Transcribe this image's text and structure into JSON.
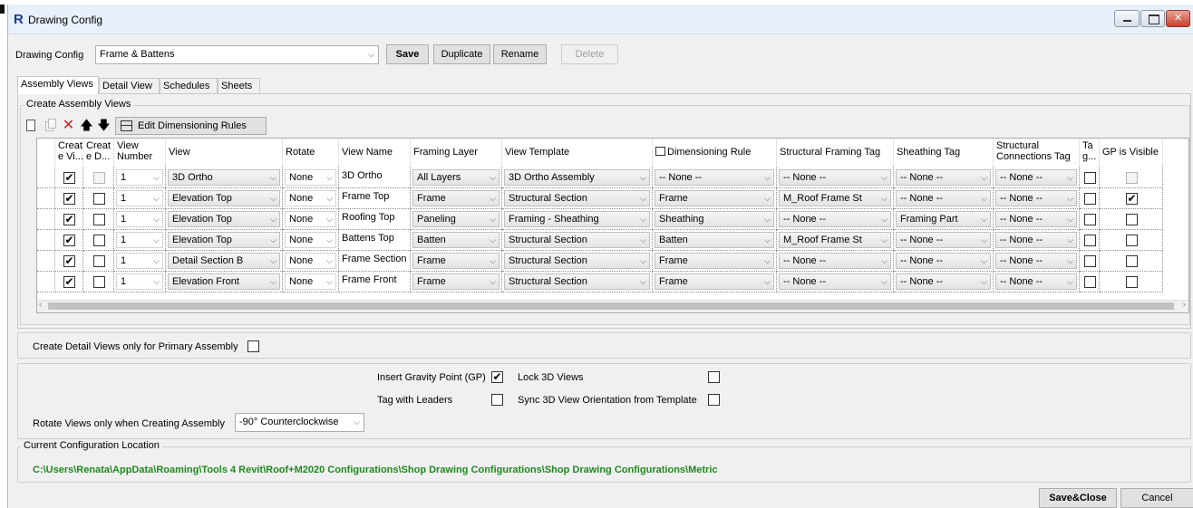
{
  "window": {
    "title": "Drawing Config",
    "logo": "R",
    "close_glyph": "✕"
  },
  "config_bar": {
    "label": "Drawing Config",
    "selected": "Frame & Battens",
    "save": "Save",
    "duplicate": "Duplicate",
    "rename": "Rename",
    "delete": "Delete"
  },
  "tabs": [
    "Assembly Views",
    "Detail View",
    "Schedules",
    "Sheets"
  ],
  "create_group": {
    "title": "Create Assembly Views",
    "edit_rules": "Edit Dimensioning Rules"
  },
  "columns": [
    "Creat\ne Vi...",
    "Creat\ne D...",
    "View\nNumber",
    "View",
    "Rotate",
    "View Name",
    "Framing Layer",
    "View Template",
    "Dimensioning Rule",
    "Structural Framing Tag",
    "Sheathing Tag",
    "Structural\nConnections Tag",
    "Ta\ng...",
    "GP is Visible"
  ],
  "rows": [
    {
      "create_view": true,
      "create_detail": false,
      "detail_disabled": true,
      "view_number": "1",
      "view": "3D Ortho",
      "rotate": "None",
      "view_name": "3D Ortho",
      "framing_layer": "All Layers",
      "view_template": "3D Ortho Assembly",
      "dim_rule": "-- None --",
      "sf_tag": "-- None --",
      "sheathing_tag": "-- None --",
      "conn_tag": "-- None --",
      "tag": false,
      "gp_visible": false,
      "gp_disabled": true
    },
    {
      "create_view": true,
      "create_detail": false,
      "detail_disabled": false,
      "view_number": "1",
      "view": "Elevation Top",
      "rotate": "None",
      "view_name": "Frame Top",
      "framing_layer": "Frame",
      "view_template": "Structural Section",
      "dim_rule": "Frame",
      "sf_tag": "M_Roof Frame St",
      "sheathing_tag": "-- None --",
      "conn_tag": "-- None --",
      "tag": false,
      "gp_visible": true,
      "gp_disabled": false
    },
    {
      "create_view": true,
      "create_detail": false,
      "detail_disabled": false,
      "view_number": "1",
      "view": "Elevation Top",
      "rotate": "None",
      "view_name": "Roofing Top",
      "framing_layer": "Paneling",
      "view_template": "Framing - Sheathing",
      "dim_rule": "Sheathing",
      "sf_tag": "-- None --",
      "sheathing_tag": "Framing Part",
      "conn_tag": "-- None --",
      "tag": false,
      "gp_visible": false,
      "gp_disabled": false
    },
    {
      "create_view": true,
      "create_detail": false,
      "detail_disabled": false,
      "view_number": "1",
      "view": "Elevation Top",
      "rotate": "None",
      "view_name": "Battens Top",
      "framing_layer": "Batten",
      "view_template": "Structural Section",
      "dim_rule": "Batten",
      "sf_tag": "M_Roof Frame St",
      "sheathing_tag": "-- None --",
      "conn_tag": "-- None --",
      "tag": false,
      "gp_visible": false,
      "gp_disabled": false
    },
    {
      "create_view": true,
      "create_detail": false,
      "detail_disabled": false,
      "view_number": "1",
      "view": "Detail Section B",
      "rotate": "None",
      "view_name": "Frame Section",
      "framing_layer": "Frame",
      "view_template": "Structural Section",
      "dim_rule": "Frame",
      "sf_tag": "-- None --",
      "sheathing_tag": "-- None --",
      "conn_tag": "-- None --",
      "tag": false,
      "gp_visible": false,
      "gp_disabled": false
    },
    {
      "create_view": true,
      "create_detail": false,
      "detail_disabled": false,
      "view_number": "1",
      "view": "Elevation Front",
      "rotate": "None",
      "view_name": "Frame Front",
      "framing_layer": "Frame",
      "view_template": "Structural Section",
      "dim_rule": "Frame",
      "sf_tag": "-- None --",
      "sheathing_tag": "-- None --",
      "conn_tag": "-- None --",
      "tag": false,
      "gp_visible": false,
      "gp_disabled": false
    }
  ],
  "primary_only": {
    "label": "Create Detail Views only for Primary Assembly",
    "checked": false
  },
  "options": {
    "insert_gp": {
      "label": "Insert Gravity Point (GP)",
      "checked": true
    },
    "lock_3d": {
      "label": "Lock 3D Views",
      "checked": false
    },
    "tag_leaders": {
      "label": "Tag with Leaders",
      "checked": false
    },
    "sync_3d": {
      "label": "Sync 3D View Orientation from Template",
      "checked": false
    },
    "rotate_label": "Rotate Views only when Creating Assembly",
    "rotate_value": "-90° Counterclockwise"
  },
  "location": {
    "title": "Current Configuration Location",
    "path": "C:\\Users\\Renata\\AppData\\Roaming\\Tools 4 Revit\\Roof+M2020 Configurations\\Shop Drawing Configurations\\Shop Drawing Configurations\\Metric"
  },
  "footer": {
    "save_close": "Save&Close",
    "cancel": "Cancel"
  },
  "colors": {
    "path_green": "#1e8a1e",
    "delete_red": "#d42020"
  }
}
